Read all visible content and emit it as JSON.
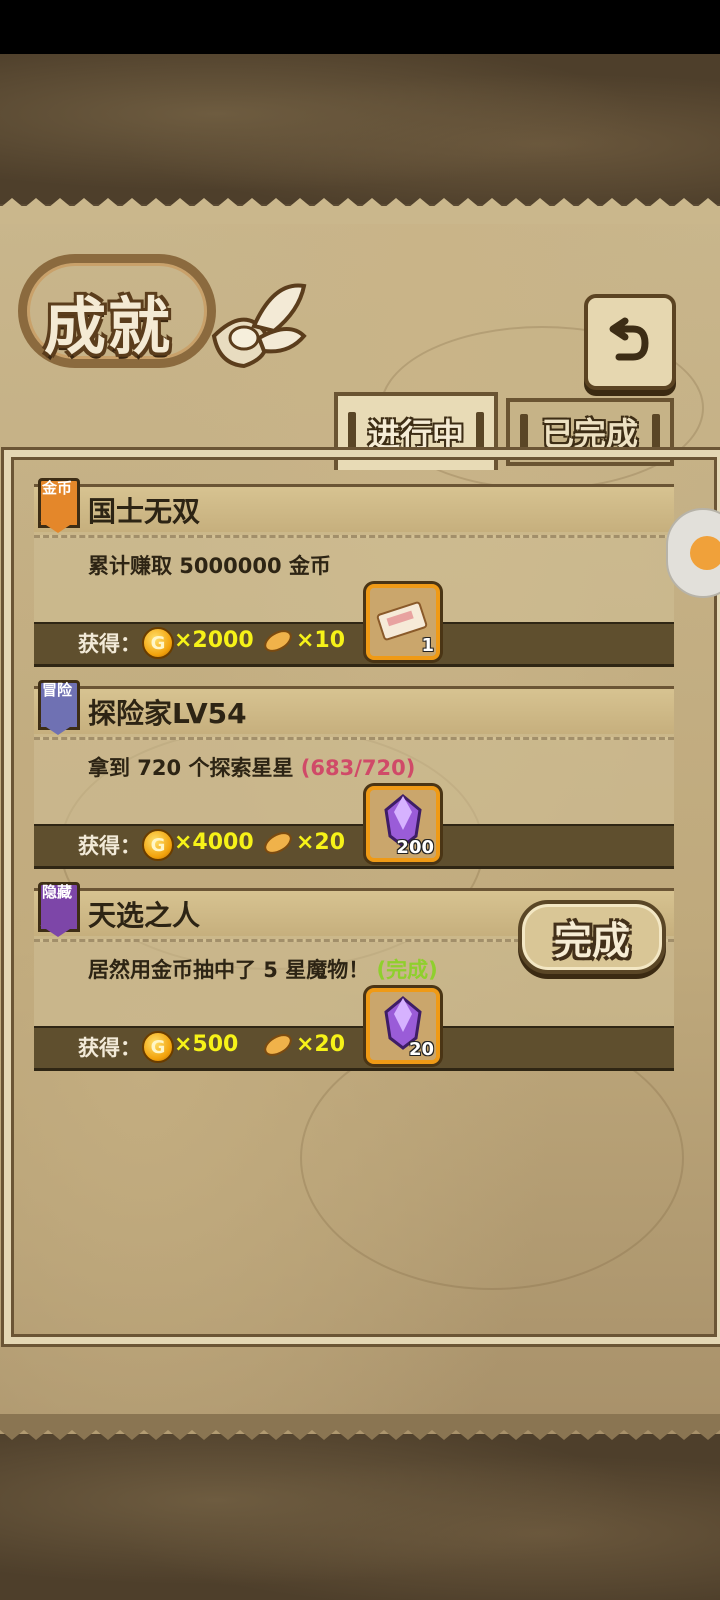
{
  "title": "成就",
  "tabs": [
    {
      "label": "进行中",
      "active": true
    },
    {
      "label": "已完成",
      "active": false
    }
  ],
  "reward_label": "获得：",
  "achievements": [
    {
      "badge": "金币",
      "badge_color": "#e4872a",
      "name": "国士无双",
      "desc": "累计赚取 5000000 金币",
      "progress": "",
      "coins": "×2000",
      "bread": "×10",
      "item": "ticket-icon",
      "item_qty": "1"
    },
    {
      "badge": "冒险",
      "badge_color": "#6f71b3",
      "name": "探险家LV54",
      "desc": "拿到 720 个探索星星",
      "progress": "(683/720)",
      "coins": "×4000",
      "bread": "×20",
      "item": "crystal-icon",
      "item_qty": "200"
    },
    {
      "badge": "隐藏",
      "badge_color": "#7d46a8",
      "name": "天选之人",
      "desc": "居然用金币抽中了 5 星魔物！",
      "progress": "(完成)",
      "coins": "×500",
      "bread": "×20",
      "item": "crystal-icon",
      "item_qty": "20",
      "claim_label": "完成"
    }
  ]
}
